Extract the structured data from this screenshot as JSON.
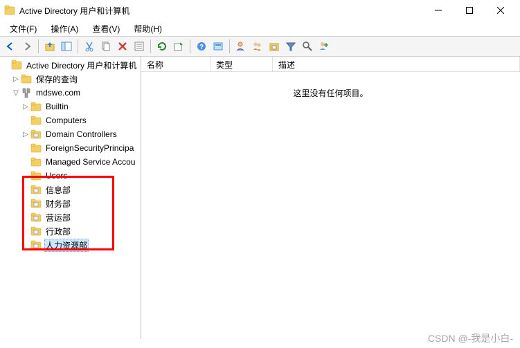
{
  "titlebar": {
    "title": "Active Directory 用户和计算机"
  },
  "menu": {
    "file": "文件(F)",
    "action": "操作(A)",
    "view": "查看(V)",
    "help": "帮助(H)"
  },
  "tree": {
    "root": "Active Directory 用户和计算机",
    "saved_queries": "保存的查询",
    "domain": "mdswe.com",
    "children": {
      "builtin": "Builtin",
      "computers": "Computers",
      "domain_controllers": "Domain Controllers",
      "fsp": "ForeignSecurityPrincipa",
      "msa": "Managed Service Accou",
      "users": "Users",
      "ou1": "信息部",
      "ou2": "财务部",
      "ou3": "营运部",
      "ou4": "行政部",
      "ou5": "人力资源部"
    }
  },
  "list": {
    "col_name": "名称",
    "col_type": "类型",
    "col_desc": "描述",
    "empty": "这里没有任何项目。"
  },
  "watermark": "CSDN @-我是小白-"
}
